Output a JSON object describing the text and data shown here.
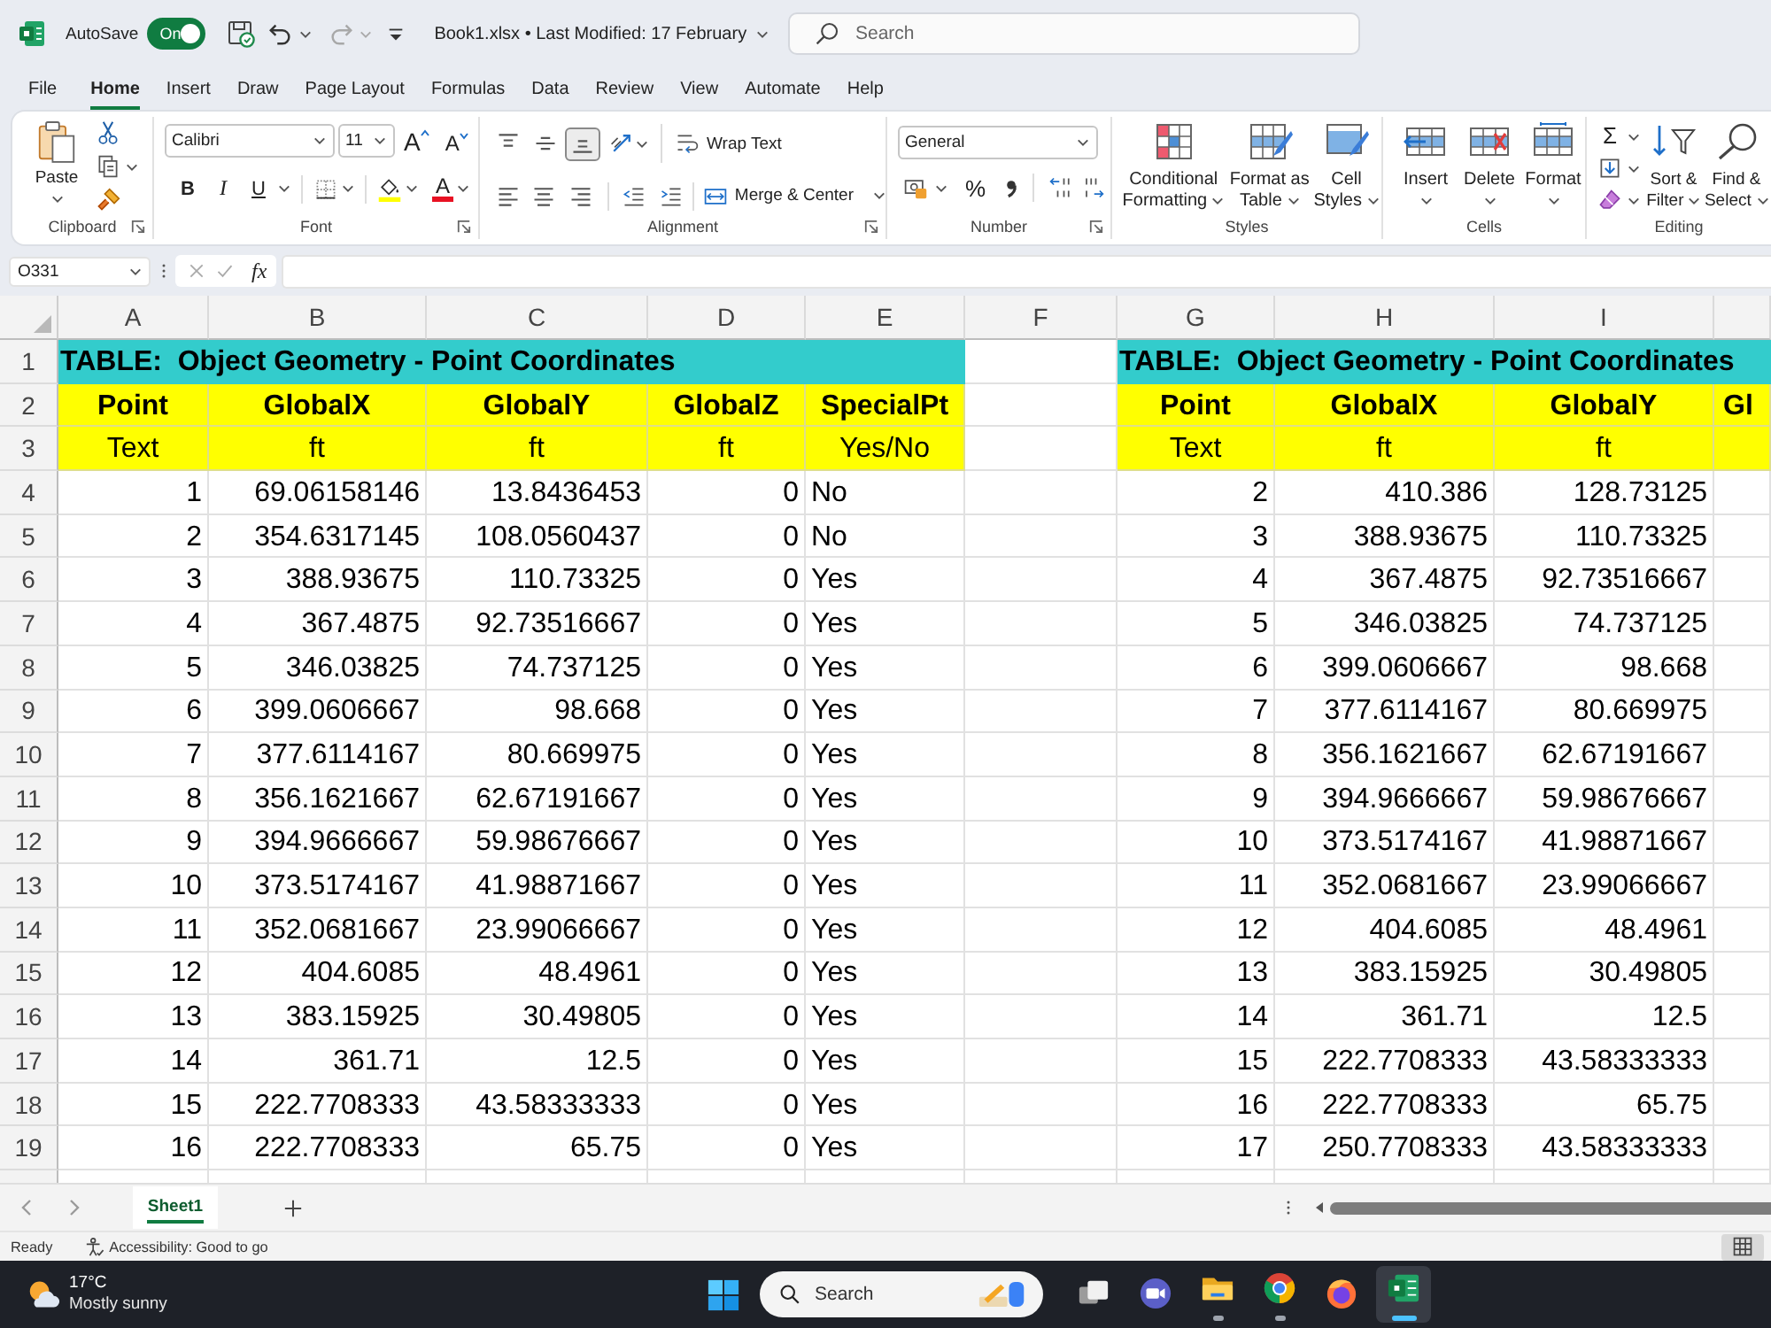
{
  "title_bar": {
    "autosave": {
      "label": "AutoSave",
      "on": true,
      "state_label": "On"
    },
    "document": "Book1.xlsx • Last Modified: 17 February",
    "search": {
      "placeholder": "Search"
    }
  },
  "menu_tabs": [
    {
      "label": "File",
      "selected": false
    },
    {
      "label": "Home",
      "selected": true
    },
    {
      "label": "Insert",
      "selected": false
    },
    {
      "label": "Draw",
      "selected": false
    },
    {
      "label": "Page Layout",
      "selected": false
    },
    {
      "label": "Formulas",
      "selected": false
    },
    {
      "label": "Data",
      "selected": false
    },
    {
      "label": "Review",
      "selected": false
    },
    {
      "label": "View",
      "selected": false
    },
    {
      "label": "Automate",
      "selected": false
    },
    {
      "label": "Help",
      "selected": false
    }
  ],
  "ribbon": {
    "clipboard": {
      "label": "Clipboard",
      "paste": "Paste"
    },
    "font": {
      "label": "Font",
      "font_name": "Calibri",
      "font_size": "11",
      "grow": "A",
      "shrink": "A",
      "bold": "B",
      "italic": "I",
      "underline": "U",
      "font_color": "A"
    },
    "alignment": {
      "label": "Alignment",
      "vertical": [
        {
          "kind": "top",
          "selected": false
        },
        {
          "kind": "middle",
          "selected": false
        },
        {
          "kind": "bottom",
          "selected": true
        }
      ],
      "horizontal": [
        {
          "kind": "left",
          "selected": false
        },
        {
          "kind": "center",
          "selected": false
        },
        {
          "kind": "right",
          "selected": false
        }
      ],
      "wrap_text": "Wrap Text",
      "merge": "Merge & Center"
    },
    "number": {
      "label": "Number",
      "format": "General",
      "percent": "%"
    },
    "styles": {
      "label": "Styles",
      "buttons": [
        {
          "kind": "conditional",
          "label": "Conditional Formatting"
        },
        {
          "kind": "table",
          "label": "Format as Table"
        },
        {
          "kind": "cell",
          "label": "Cell Styles"
        }
      ]
    },
    "cells": {
      "label": "Cells",
      "buttons": [
        {
          "kind": "insert",
          "label": "Insert"
        },
        {
          "kind": "delete",
          "label": "Delete"
        },
        {
          "kind": "format",
          "label": "Format"
        }
      ]
    },
    "editing": {
      "label": "Editing",
      "sum": "Σ",
      "buttons": [
        {
          "kind": "sort",
          "label": "Sort & Filter"
        },
        {
          "kind": "find",
          "label": "Find & Select"
        }
      ]
    }
  },
  "formula_bar": {
    "name_box": "O331",
    "function_label": "fx"
  },
  "sheet": {
    "columns": [
      "A",
      "B",
      "C",
      "D",
      "E",
      "F",
      "G",
      "H",
      "I"
    ],
    "rows": [
      "1",
      "2",
      "3",
      "4",
      "5",
      "6",
      "7",
      "8",
      "9",
      "10",
      "11",
      "12",
      "13",
      "14",
      "15",
      "16",
      "17",
      "18",
      "19"
    ],
    "tables": [
      {
        "title": "TABLE:  Object Geometry - Point Coordinates",
        "headings": [
          {
            "label": "Point",
            "kind": "number"
          },
          {
            "label": "GlobalX",
            "kind": "number"
          },
          {
            "label": "GlobalY",
            "kind": "number"
          },
          {
            "label": "GlobalZ",
            "kind": "number"
          },
          {
            "label": "SpecialPt",
            "kind": "text"
          }
        ],
        "units": [
          "Text",
          "ft",
          "ft",
          "ft",
          "Yes/No"
        ],
        "rows": [
          [
            "1",
            "69.06158146",
            "13.8436453",
            "0",
            "No"
          ],
          [
            "2",
            "354.6317145",
            "108.0560437",
            "0",
            "No"
          ],
          [
            "3",
            "388.93675",
            "110.73325",
            "0",
            "Yes"
          ],
          [
            "4",
            "367.4875",
            "92.73516667",
            "0",
            "Yes"
          ],
          [
            "5",
            "346.03825",
            "74.737125",
            "0",
            "Yes"
          ],
          [
            "6",
            "399.0606667",
            "98.668",
            "0",
            "Yes"
          ],
          [
            "7",
            "377.6114167",
            "80.669975",
            "0",
            "Yes"
          ],
          [
            "8",
            "356.1621667",
            "62.67191667",
            "0",
            "Yes"
          ],
          [
            "9",
            "394.9666667",
            "59.98676667",
            "0",
            "Yes"
          ],
          [
            "10",
            "373.5174167",
            "41.98871667",
            "0",
            "Yes"
          ],
          [
            "11",
            "352.0681667",
            "23.99066667",
            "0",
            "Yes"
          ],
          [
            "12",
            "404.6085",
            "48.4961",
            "0",
            "Yes"
          ],
          [
            "13",
            "383.15925",
            "30.49805",
            "0",
            "Yes"
          ],
          [
            "14",
            "361.71",
            "12.5",
            "0",
            "Yes"
          ],
          [
            "15",
            "222.7708333",
            "43.58333333",
            "0",
            "Yes"
          ],
          [
            "16",
            "222.7708333",
            "65.75",
            "0",
            "Yes"
          ]
        ]
      },
      {
        "title": "TABLE:  Object Geometry - Point Coordinates",
        "headings": [
          {
            "label": "Point",
            "kind": "number"
          },
          {
            "label": "GlobalX",
            "kind": "number"
          },
          {
            "label": "GlobalY",
            "kind": "number"
          },
          {
            "label": "Gl"
          }
        ],
        "units": [
          "Text",
          "ft",
          "ft"
        ],
        "rows": [
          [
            "2",
            "410.386",
            "128.73125"
          ],
          [
            "3",
            "388.93675",
            "110.73325"
          ],
          [
            "4",
            "367.4875",
            "92.73516667"
          ],
          [
            "5",
            "346.03825",
            "74.737125"
          ],
          [
            "6",
            "399.0606667",
            "98.668"
          ],
          [
            "7",
            "377.6114167",
            "80.669975"
          ],
          [
            "8",
            "356.1621667",
            "62.67191667"
          ],
          [
            "9",
            "394.9666667",
            "59.98676667"
          ],
          [
            "10",
            "373.5174167",
            "41.98871667"
          ],
          [
            "11",
            "352.0681667",
            "23.99066667"
          ],
          [
            "12",
            "404.6085",
            "48.4961"
          ],
          [
            "13",
            "383.15925",
            "30.49805"
          ],
          [
            "14",
            "361.71",
            "12.5"
          ],
          [
            "15",
            "222.7708333",
            "43.58333333"
          ],
          [
            "16",
            "222.7708333",
            "65.75"
          ],
          [
            "17",
            "250.7708333",
            "43.58333333"
          ]
        ]
      }
    ]
  },
  "sheet_tabs": [
    {
      "label": "Sheet1",
      "selected": true
    }
  ],
  "status_bar": {
    "mode": "Ready",
    "accessibility": "Accessibility: Good to go",
    "views": [
      {
        "kind": "normal",
        "selected": true
      }
    ]
  },
  "taskbar": {
    "weather": {
      "temperature": "17°C",
      "condition": "Mostly sunny"
    },
    "search": {
      "placeholder": "Search"
    },
    "apps": [
      {
        "kind": "task-view",
        "running": false,
        "selected": false
      },
      {
        "kind": "meet",
        "running": false,
        "selected": false
      },
      {
        "kind": "folder",
        "running": true,
        "selected": false
      },
      {
        "kind": "chrome",
        "running": true,
        "selected": false
      },
      {
        "kind": "firefox",
        "running": false,
        "selected": false
      },
      {
        "kind": "excel",
        "running": true,
        "selected": true
      }
    ]
  }
}
